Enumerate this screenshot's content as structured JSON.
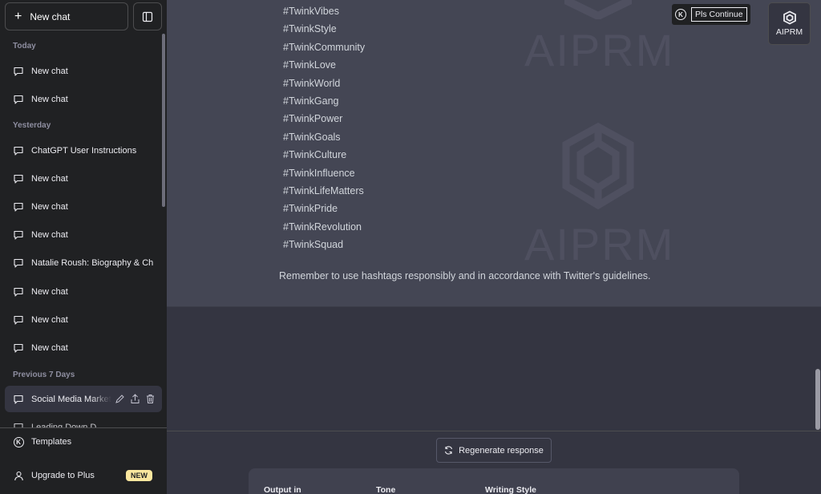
{
  "sidebar": {
    "new_chat_label": "New chat",
    "groups": {
      "today": "Today",
      "yesterday": "Yesterday",
      "previous_7_days": "Previous 7 Days"
    },
    "today_items": [
      "New chat",
      "New chat"
    ],
    "yesterday_items": [
      "ChatGPT User Instructions",
      "New chat",
      "New chat",
      "New chat",
      "Natalie Roush: Biography & Ch",
      "New chat",
      "New chat",
      "New chat"
    ],
    "previous_items": [
      "Social Media Market",
      "Leading Down D..."
    ],
    "templates_label": "Templates",
    "upgrade_label": "Upgrade to Plus",
    "new_badge": "NEW"
  },
  "message": {
    "hashtags": [
      "#TwinkVibes",
      "#TwinkStyle",
      "#TwinkCommunity",
      "#TwinkLove",
      "#TwinkWorld",
      "#TwinkGang",
      "#TwinkPower",
      "#TwinkGoals",
      "#TwinkCulture",
      "#TwinkInfluence",
      "#TwinkLifeMatters",
      "#TwinkPride",
      "#TwinkRevolution",
      "#TwinkSquad"
    ],
    "closing": "Remember to use hashtags responsibly and in accordance with Twitter's guidelines.",
    "watermark_text": "AIPRM"
  },
  "toolbar": {
    "pls_continue_label": "Pls Continue",
    "aiprm_label": "AIPRM"
  },
  "input": {
    "regenerate_label": "Regenerate response",
    "output_in_label": "Output in",
    "tone_label": "Tone",
    "writing_style_label": "Writing Style"
  },
  "colors": {
    "sidebar_bg": "#202123",
    "main_bg": "#343541",
    "message_bg": "#444654",
    "badge_bg": "#fae69e"
  }
}
